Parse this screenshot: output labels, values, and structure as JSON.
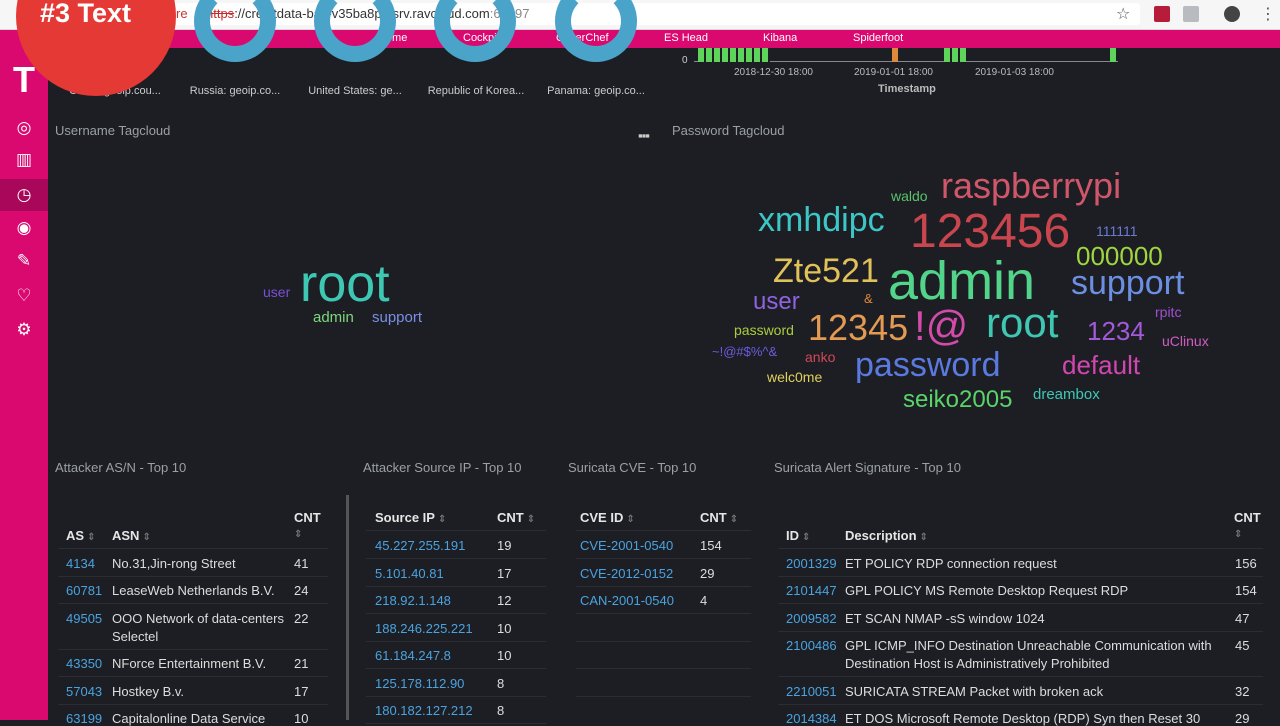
{
  "badge": "#3 Text",
  "browser": {
    "not_secure": "re",
    "url_https": "https",
    "url_rest": "://creditdata-bait-v35ba8p6.srv.ravcloud.com",
    "url_port": ":64297"
  },
  "topnav": [
    "Home",
    "Cockpit",
    "CyberChef",
    "ES Head",
    "Kibana",
    "Spiderfoot"
  ],
  "donuts": [
    {
      "label": "China: geoip.cou..."
    },
    {
      "label": "Russia: geoip.co..."
    },
    {
      "label": "United States: ge..."
    },
    {
      "label": "Republic of Korea..."
    },
    {
      "label": "Panama: geoip.co..."
    }
  ],
  "histogram": {
    "zero": "0",
    "ticks": [
      "2018-12-30 18:00",
      "2019-01-01 18:00",
      "2019-01-03 18:00"
    ],
    "title": "Timestamp"
  },
  "username_cloud": {
    "title": "Username Tagcloud",
    "words": [
      {
        "text": "root",
        "color": "#3ec8b4"
      },
      {
        "text": "user",
        "color": "#7b4fd6"
      },
      {
        "text": "admin",
        "color": "#7dd87c"
      },
      {
        "text": "support",
        "color": "#7b8fe6"
      }
    ]
  },
  "password_cloud": {
    "title": "Password Tagcloud",
    "words": [
      {
        "text": "raspberrypi",
        "color": "#d0576a"
      },
      {
        "text": "waldo",
        "color": "#58c46a"
      },
      {
        "text": "xmhdipc",
        "color": "#3cc7c7"
      },
      {
        "text": "123456",
        "color": "#c9464e"
      },
      {
        "text": "111111",
        "color": "#6a7bd6"
      },
      {
        "text": "000000",
        "color": "#9fd640"
      },
      {
        "text": "Zte521",
        "color": "#e0c15a"
      },
      {
        "text": "admin",
        "color": "#52d48a"
      },
      {
        "text": "support",
        "color": "#6d8fe2"
      },
      {
        "text": "user",
        "color": "#8f63e0"
      },
      {
        "text": "&",
        "color": "#e0893a"
      },
      {
        "text": "rpitc",
        "color": "#a14fd0"
      },
      {
        "text": "password",
        "color": "#aacd3e"
      },
      {
        "text": "12345",
        "color": "#e39a52"
      },
      {
        "text": "!@",
        "color": "#d24baa"
      },
      {
        "text": "root",
        "color": "#3ec8b4"
      },
      {
        "text": "1234",
        "color": "#a25ad8"
      },
      {
        "text": "uClinux",
        "color": "#d05cc0"
      },
      {
        "text": "~!@#$%^&",
        "color": "#6a5ce0"
      },
      {
        "text": "anko",
        "color": "#d0485a"
      },
      {
        "text": "password",
        "color": "#5a7ae0"
      },
      {
        "text": "default",
        "color": "#d246b0"
      },
      {
        "text": "welc0me",
        "color": "#e0d05a"
      },
      {
        "text": "seiko2005",
        "color": "#5ad46a"
      },
      {
        "text": "dreambox",
        "color": "#3ec8b4"
      }
    ]
  },
  "asn_table": {
    "title": "Attacker AS/N - Top 10",
    "headers": [
      "AS",
      "ASN",
      "CNT"
    ],
    "rows": [
      {
        "as": "4134",
        "asn": "No.31,Jin-rong Street",
        "cnt": "41"
      },
      {
        "as": "60781",
        "asn": "LeaseWeb Netherlands B.V.",
        "cnt": "24"
      },
      {
        "as": "49505",
        "asn": "OOO Network of data-centers",
        "asn2": "Selectel",
        "cnt": "22"
      },
      {
        "as": "43350",
        "asn": "NForce Entertainment B.V.",
        "cnt": "21"
      },
      {
        "as": "57043",
        "asn": "Hostkey B.v.",
        "cnt": "17"
      },
      {
        "as": "63199",
        "asn": "Capitalonline Data Service",
        "cnt": "10"
      }
    ]
  },
  "ip_table": {
    "title": "Attacker Source IP - Top 10",
    "headers": [
      "Source IP",
      "CNT"
    ],
    "rows": [
      {
        "ip": "45.227.255.191",
        "cnt": "19"
      },
      {
        "ip": "5.101.40.81",
        "cnt": "17"
      },
      {
        "ip": "218.92.1.148",
        "cnt": "12"
      },
      {
        "ip": "188.246.225.221",
        "cnt": "10"
      },
      {
        "ip": "61.184.247.8",
        "cnt": "10"
      },
      {
        "ip": "125.178.112.90",
        "cnt": "8"
      },
      {
        "ip": "180.182.127.212",
        "cnt": "8"
      }
    ]
  },
  "cve_table": {
    "title": "Suricata CVE - Top 10",
    "headers": [
      "CVE ID",
      "CNT"
    ],
    "rows": [
      {
        "id": "CVE-2001-0540",
        "cnt": "154"
      },
      {
        "id": "CVE-2012-0152",
        "cnt": "29"
      },
      {
        "id": "CAN-2001-0540",
        "cnt": "4"
      }
    ]
  },
  "sig_table": {
    "title": "Suricata Alert Signature - Top 10",
    "headers": [
      "ID",
      "Description",
      "CNT"
    ],
    "rows": [
      {
        "id": "2001329",
        "desc": "ET POLICY RDP connection request",
        "cnt": "156"
      },
      {
        "id": "2101447",
        "desc": "GPL POLICY MS Remote Desktop Request RDP",
        "cnt": "154"
      },
      {
        "id": "2009582",
        "desc": "ET SCAN NMAP -sS window 1024",
        "cnt": "47"
      },
      {
        "id": "2100486",
        "desc": "GPL ICMP_INFO Destination Unreachable Communication with",
        "desc2": "Destination Host is Administratively Prohibited",
        "cnt": "45"
      },
      {
        "id": "2210051",
        "desc": "SURICATA STREAM Packet with broken ack",
        "cnt": "32"
      },
      {
        "id": "2014384",
        "desc": "ET DOS Microsoft Remote Desktop (RDP) Syn then Reset 30",
        "cnt": "29"
      }
    ]
  }
}
